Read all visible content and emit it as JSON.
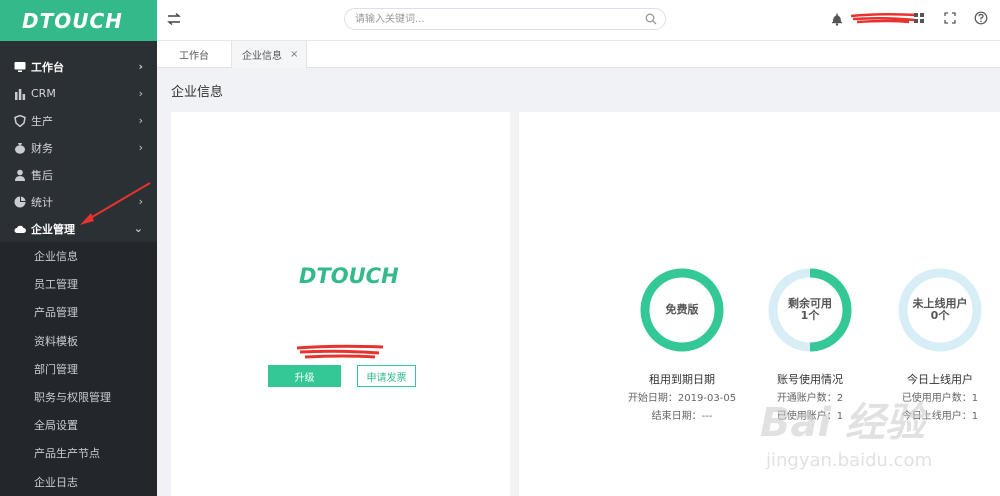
{
  "app": {
    "logo": "DTOUCH",
    "accent": "#34b98a"
  },
  "sidebar": {
    "items": [
      {
        "label": "工作台",
        "icon": "monitor-icon",
        "arrow": "›"
      },
      {
        "label": "CRM",
        "icon": "bar-chart-icon",
        "arrow": "›"
      },
      {
        "label": "生产",
        "icon": "shield-icon",
        "arrow": "›"
      },
      {
        "label": "财务",
        "icon": "money-bag-icon",
        "arrow": "›"
      },
      {
        "label": "售后",
        "icon": "user-icon",
        "arrow": ""
      },
      {
        "label": "统计",
        "icon": "pie-chart-icon",
        "arrow": "›"
      },
      {
        "label": "企业管理",
        "icon": "cloud-icon",
        "arrow": "⌄"
      }
    ],
    "sub_items": [
      "企业信息",
      "员工管理",
      "产品管理",
      "资料模板",
      "部门管理",
      "职务与权限管理",
      "全局设置",
      "产品生产节点",
      "企业日志"
    ]
  },
  "header": {
    "search_placeholder": "请输入关键词..."
  },
  "tabs": [
    {
      "label": "工作台"
    },
    {
      "label": "企业信息",
      "close": "×"
    }
  ],
  "page": {
    "title": "企业信息"
  },
  "company_card": {
    "logo": "DTOUCH",
    "upgrade_label": "升级",
    "invoice_label": "申请发票"
  },
  "stats": [
    {
      "ring_text": "免费版",
      "title": "租用到期日期",
      "lines": [
        "开始日期：2019-03-05",
        "结束日期：---"
      ]
    },
    {
      "ring_text": "剩余可用",
      "ring_sub": "1个",
      "title": "账号使用情况",
      "lines": [
        "开通账户数：2",
        "已使用账户：1"
      ],
      "fill_fraction": 0.5
    },
    {
      "ring_text": "未上线用户",
      "ring_sub": "0个",
      "title": "今日上线用户",
      "lines": [
        "已使用用户数：1",
        "今日上线用户：1"
      ],
      "fill_fraction": 0
    }
  ],
  "watermark": {
    "main": "Bai 经验",
    "sub": "jingyan.baidu.com"
  }
}
